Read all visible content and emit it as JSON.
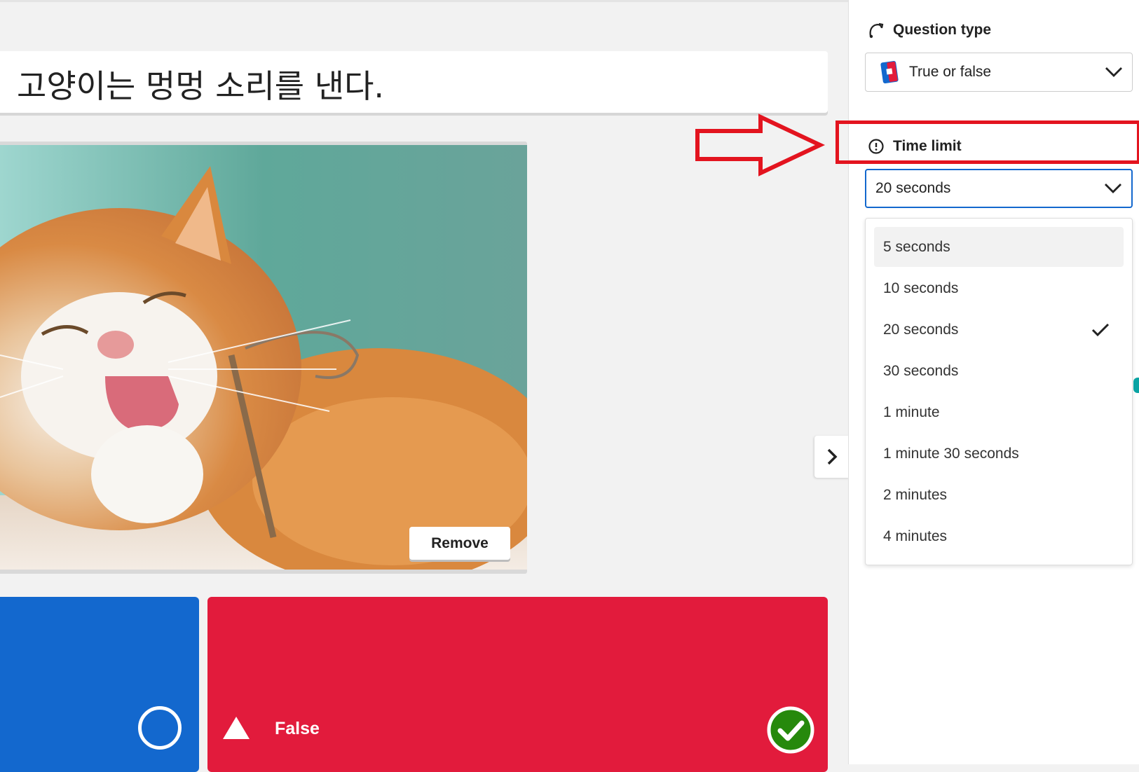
{
  "question": {
    "text": "고양이는 멍멍 소리를 낸다."
  },
  "media": {
    "remove_label": "Remove"
  },
  "answers": [
    {
      "label": "",
      "color": "#1368ce",
      "shape": "circle-icon",
      "correct": false
    },
    {
      "label": "False",
      "color": "#e21b3c",
      "shape": "triangle-icon",
      "correct": true
    }
  ],
  "sidebar": {
    "question_type": {
      "label": "Question type",
      "value": "True or false"
    },
    "time_limit": {
      "label": "Time limit",
      "value": "20 seconds",
      "options": [
        {
          "label": "5 seconds"
        },
        {
          "label": "10 seconds"
        },
        {
          "label": "20 seconds",
          "selected": true
        },
        {
          "label": "30 seconds"
        },
        {
          "label": "1 minute"
        },
        {
          "label": "1 minute 30 seconds"
        },
        {
          "label": "2 minutes"
        },
        {
          "label": "4 minutes"
        }
      ]
    }
  },
  "colors": {
    "blue": "#1368ce",
    "red": "#e21b3c",
    "green_check": "#26890c",
    "annotation": "#e3141f",
    "focus": "#1368ce"
  }
}
